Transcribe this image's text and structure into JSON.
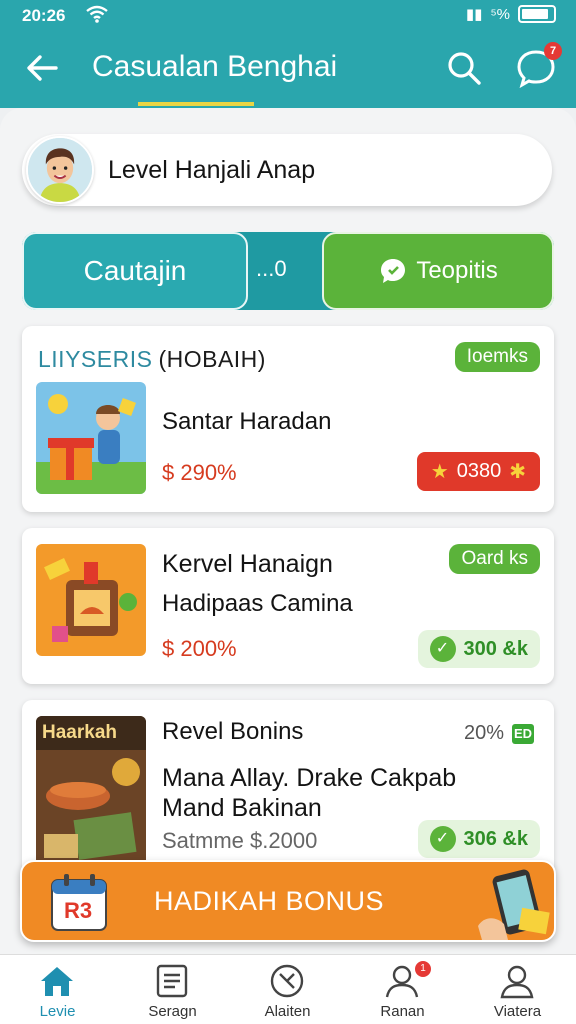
{
  "status": {
    "time": "20:26",
    "right_text": "⁵%"
  },
  "appbar": {
    "title": "Casualan Benghai",
    "chat_badge": "7"
  },
  "profile": {
    "name": "Level Hanjali Anap"
  },
  "segments": {
    "left": "Cautajin",
    "middle": "...0",
    "right": "Teopitis"
  },
  "cards": [
    {
      "heading": "LIIYSERIS",
      "heading_paren": "(HOBAIH)",
      "tag": "Ioemks",
      "title": "Santar Haradan",
      "price": "$ 290%",
      "action": "0380"
    },
    {
      "tag": "Oard ks",
      "title": "Kervel Hanaign",
      "subtitle": "Hadipaas Camina",
      "price": "$ 200%",
      "action": "300 &k"
    },
    {
      "thumb_label": "Haarkah",
      "title": "Revel Bonins",
      "percent": "20%",
      "percent_icon": "ED",
      "subtitle_line1": "Mana Allay. Drake Cakpab",
      "subtitle_line2": "Mand Bakinan",
      "price": "Satmme $.2000",
      "action": "306 &k"
    }
  ],
  "banner": {
    "label": "HADIKAH BONUS",
    "calendar_text": "R3"
  },
  "nav": [
    {
      "label": "Levie",
      "icon": "home-icon"
    },
    {
      "label": "Seragn",
      "icon": "list-icon"
    },
    {
      "label": "Alaiten",
      "icon": "compass-icon"
    },
    {
      "label": "Ranan",
      "icon": "person-icon",
      "badge": "1"
    },
    {
      "label": "Viatera",
      "icon": "account-icon"
    }
  ],
  "colors": {
    "teal": "#2aa6ad",
    "green": "#5bb33a",
    "orange": "#f08a24",
    "red": "#e0392a"
  }
}
